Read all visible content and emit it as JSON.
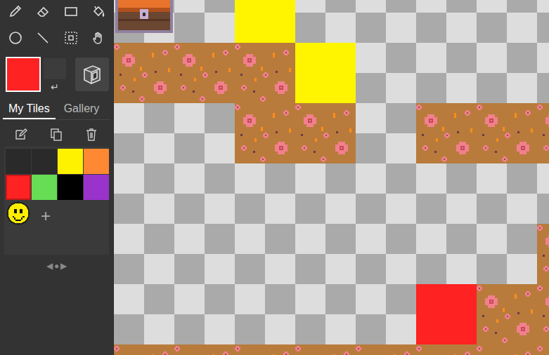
{
  "colors": {
    "primary": "#fe2222",
    "secondary": "#3c3c3c",
    "swap": "↵"
  },
  "tabs": [
    {
      "label": "My Tiles",
      "selected": true
    },
    {
      "label": "Gallery",
      "selected": false
    }
  ],
  "palette": [
    {
      "kind": "color",
      "color": "#2a2a2a",
      "selected": false
    },
    {
      "kind": "color",
      "color": "#2a2a2a",
      "selected": false
    },
    {
      "kind": "color",
      "color": "#fff200",
      "selected": false
    },
    {
      "kind": "color",
      "color": "#ff8833",
      "selected": false
    },
    {
      "kind": "color",
      "color": "#fe2222",
      "selected": true
    },
    {
      "kind": "color",
      "color": "#66dd55",
      "selected": false
    },
    {
      "kind": "color",
      "color": "#000000",
      "selected": false
    },
    {
      "kind": "color",
      "color": "#9933cc",
      "selected": false
    },
    {
      "kind": "smiley",
      "selected": false
    }
  ],
  "add_tile": "+",
  "pager": {
    "prev": "◀",
    "dot": "●",
    "next": "▶"
  },
  "map": {
    "rows": [
      [
        {
          "kind": "chest"
        },
        {
          "kind": "empty"
        },
        {
          "kind": "color",
          "color": "#fff500"
        },
        {
          "kind": "empty"
        },
        {
          "kind": "empty"
        },
        {
          "kind": "empty"
        },
        {
          "kind": "empty"
        },
        {
          "kind": "empty"
        }
      ],
      [
        {
          "kind": "flowers"
        },
        {
          "kind": "flowers"
        },
        {
          "kind": "flowers"
        },
        {
          "kind": "color",
          "color": "#fff500"
        },
        {
          "kind": "empty"
        },
        {
          "kind": "empty"
        },
        {
          "kind": "empty"
        },
        {
          "kind": "empty"
        }
      ],
      [
        {
          "kind": "empty"
        },
        {
          "kind": "empty"
        },
        {
          "kind": "flowers"
        },
        {
          "kind": "flowers"
        },
        {
          "kind": "empty"
        },
        {
          "kind": "flowers"
        },
        {
          "kind": "flowers"
        },
        {
          "kind": "flowers"
        }
      ],
      [
        {
          "kind": "empty"
        },
        {
          "kind": "empty"
        },
        {
          "kind": "empty"
        },
        {
          "kind": "empty"
        },
        {
          "kind": "empty"
        },
        {
          "kind": "empty"
        },
        {
          "kind": "empty"
        },
        {
          "kind": "empty"
        }
      ],
      [
        {
          "kind": "empty"
        },
        {
          "kind": "empty"
        },
        {
          "kind": "empty"
        },
        {
          "kind": "empty"
        },
        {
          "kind": "empty"
        },
        {
          "kind": "empty"
        },
        {
          "kind": "empty"
        },
        {
          "kind": "flowers"
        }
      ],
      [
        {
          "kind": "empty"
        },
        {
          "kind": "empty"
        },
        {
          "kind": "empty"
        },
        {
          "kind": "empty"
        },
        {
          "kind": "empty"
        },
        {
          "kind": "color",
          "color": "#fe2222"
        },
        {
          "kind": "flowers"
        },
        {
          "kind": "flowers"
        }
      ],
      [
        {
          "kind": "flowers"
        },
        {
          "kind": "flowers"
        },
        {
          "kind": "flowers"
        },
        {
          "kind": "flowers"
        },
        {
          "kind": "flowers"
        },
        {
          "kind": "flowers"
        },
        {
          "kind": "flowers"
        },
        {
          "kind": "flowers"
        }
      ]
    ]
  }
}
